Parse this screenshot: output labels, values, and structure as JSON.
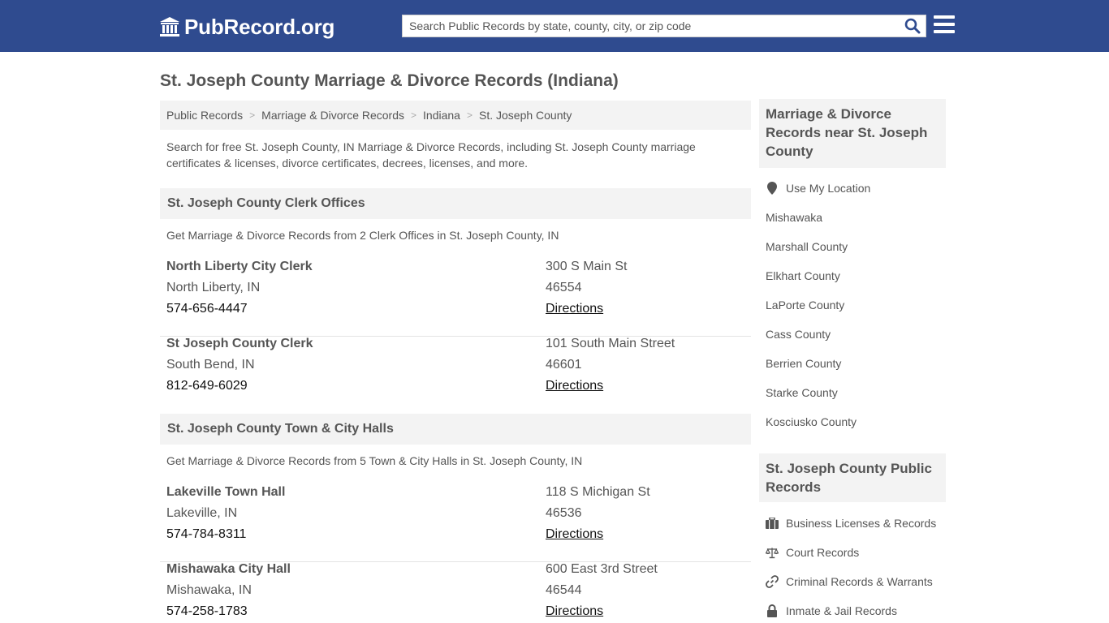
{
  "header": {
    "logo_text": "PubRecord.org",
    "search_placeholder": "Search Public Records by state, county, city, or zip code",
    "brand_color": "#2f4b8f"
  },
  "page": {
    "title": "St. Joseph County Marriage & Divorce Records (Indiana)",
    "breadcrumb": [
      "Public Records",
      "Marriage & Divorce Records",
      "Indiana",
      "St. Joseph County"
    ],
    "intro": "Search for free St. Joseph County, IN Marriage & Divorce Records, including St. Joseph County marriage certificates & licenses, divorce certificates, decrees, licenses, and more."
  },
  "sections": [
    {
      "title": "St. Joseph County Clerk Offices",
      "subtitle": "Get Marriage & Divorce Records from 2 Clerk Offices in St. Joseph County, IN",
      "offices": [
        {
          "name": "North Liberty City Clerk",
          "city": "North Liberty, IN",
          "phone": "574-656-4447",
          "street": "300 S Main St",
          "zip": "46554",
          "directions": "Directions"
        },
        {
          "name": "St Joseph County Clerk",
          "city": "South Bend, IN",
          "phone": "812-649-6029",
          "street": "101 South Main Street",
          "zip": "46601",
          "directions": "Directions"
        }
      ]
    },
    {
      "title": "St. Joseph County Town & City Halls",
      "subtitle": "Get Marriage & Divorce Records from 5 Town & City Halls in St. Joseph County, IN",
      "offices": [
        {
          "name": "Lakeville Town Hall",
          "city": "Lakeville, IN",
          "phone": "574-784-8311",
          "street": "118 S Michigan St",
          "zip": "46536",
          "directions": "Directions"
        },
        {
          "name": "Mishawaka City Hall",
          "city": "Mishawaka, IN",
          "phone": "574-258-1783",
          "street": "600 East 3rd Street",
          "zip": "46544",
          "directions": "Directions"
        }
      ]
    }
  ],
  "sidebar": {
    "nearby_title": "Marriage & Divorce Records near St. Joseph County",
    "nearby_links": [
      "Use My Location",
      "Mishawaka",
      "Marshall County",
      "Elkhart County",
      "LaPorte County",
      "Cass County",
      "Berrien County",
      "Starke County",
      "Kosciusko County"
    ],
    "public_title": "St. Joseph County Public Records",
    "public_links": [
      {
        "label": "Business Licenses & Records",
        "icon": "briefcase-icon"
      },
      {
        "label": "Court Records",
        "icon": "scales-icon"
      },
      {
        "label": "Criminal Records & Warrants",
        "icon": "link-icon"
      },
      {
        "label": "Inmate & Jail Records",
        "icon": "lock-icon"
      }
    ]
  }
}
